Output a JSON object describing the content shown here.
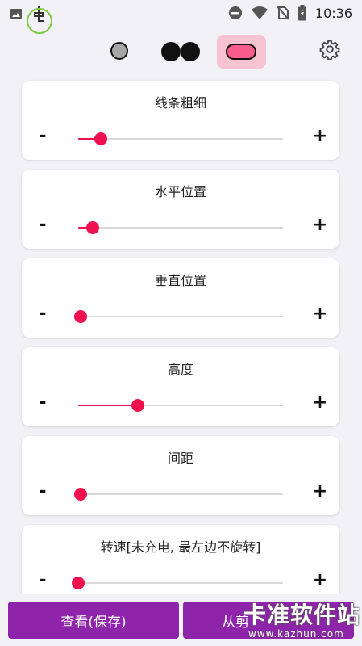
{
  "status_bar": {
    "time": "10:36",
    "icons": [
      "image-icon",
      "app-icon",
      "do-not-disturb-icon",
      "wifi-icon",
      "no-sim-icon",
      "battery-icon"
    ]
  },
  "toolbar": {
    "modes": [
      "single-dot-mode-icon",
      "double-dot-mode-icon",
      "pill-mode-icon"
    ],
    "selected_mode": "pill-mode-icon",
    "settings_icon": "gear-icon"
  },
  "sliders": [
    {
      "label": "线条粗细",
      "minus": "-",
      "plus": "+",
      "value_percent": 11
    },
    {
      "label": "水平位置",
      "minus": "-",
      "plus": "+",
      "value_percent": 7
    },
    {
      "label": "垂直位置",
      "minus": "-",
      "plus": "+",
      "value_percent": 1
    },
    {
      "label": "高度",
      "minus": "-",
      "plus": "+",
      "value_percent": 29
    },
    {
      "label": "间距",
      "minus": "-",
      "plus": "+",
      "value_percent": 1
    },
    {
      "label": "转速[未充电, 最左边不旋转]",
      "minus": "-",
      "plus": "+",
      "value_percent": 0
    }
  ],
  "bottom": {
    "view_save_label": "查看(保存)",
    "clip_label": "从剪"
  },
  "watermark": {
    "main": "卡准软件站",
    "sub": "www.kazhun.com"
  },
  "colors": {
    "accent": "#f0104f",
    "button": "#8e24aa",
    "selected_mode_bg": "#f7c2d2"
  }
}
